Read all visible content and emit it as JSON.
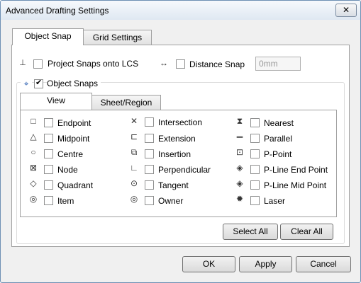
{
  "window": {
    "title": "Advanced Drafting Settings",
    "close_glyph": "✕"
  },
  "tabs": {
    "object_snap": "Object Snap",
    "grid_settings": "Grid Settings"
  },
  "top": {
    "project_snaps": "Project Snaps onto LCS",
    "distance_snap": "Distance Snap",
    "distance_value": "0mm",
    "object_snaps": "Object Snaps"
  },
  "inner_tabs": {
    "view": "View",
    "sheet_region": "Sheet/Region"
  },
  "snaps": {
    "col1": [
      "Endpoint",
      "Midpoint",
      "Centre",
      "Node",
      "Quadrant",
      "Item"
    ],
    "col2": [
      "Intersection",
      "Extension",
      "Insertion",
      "Perpendicular",
      "Tangent",
      "Owner"
    ],
    "col3": [
      "Nearest",
      "Parallel",
      "P-Point",
      "P-Line End Point",
      "P-Line Mid Point",
      "Laser"
    ]
  },
  "buttons": {
    "select_all": "Select All",
    "clear_all": "Clear All",
    "ok": "OK",
    "apply": "Apply",
    "cancel": "Cancel"
  }
}
